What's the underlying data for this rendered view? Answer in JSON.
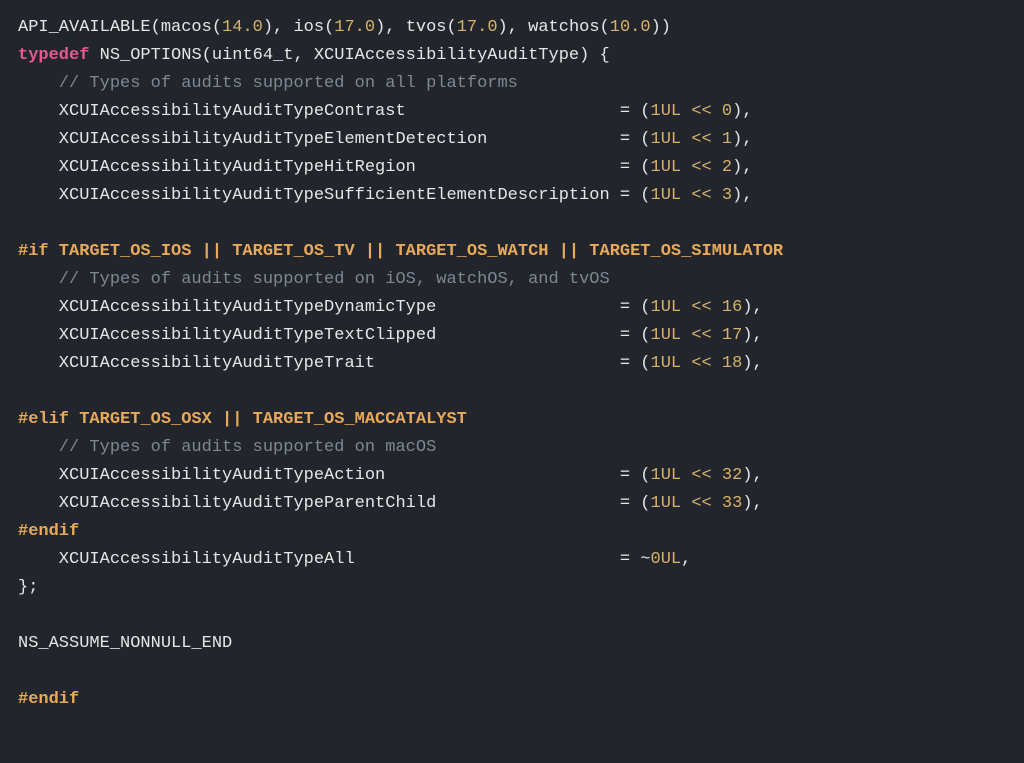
{
  "code": {
    "line1_api": "API_AVAILABLE(macos(",
    "line1_v1": "14.0",
    "line1_b": "), ios(",
    "line1_v2": "17.0",
    "line1_c": "), tvos(",
    "line1_v3": "17.0",
    "line1_d": "), watchos(",
    "line1_v4": "10.0",
    "line1_e": "))",
    "typedef": "typedef",
    "ns_opts": " NS_OPTIONS(uint64_t, XCUIAccessibilityAuditType) {",
    "cmt_all": "    // Types of audits supported on all platforms",
    "enum1_name": "    XCUIAccessibilityAuditTypeContrast                     = (",
    "enum1_val": "1UL << 0",
    "enum1_tail": "),",
    "enum2_name": "    XCUIAccessibilityAuditTypeElementDetection             = (",
    "enum2_val": "1UL << 1",
    "enum2_tail": "),",
    "enum3_name": "    XCUIAccessibilityAuditTypeHitRegion                    = (",
    "enum3_val": "1UL << 2",
    "enum3_tail": "),",
    "enum4_name": "    XCUIAccessibilityAuditTypeSufficientElementDescription = (",
    "enum4_val": "1UL << 3",
    "enum4_tail": "),",
    "blank": "    ",
    "pp_if": "#if TARGET_OS_IOS || TARGET_OS_TV || TARGET_OS_WATCH || TARGET_OS_SIMULATOR",
    "cmt_ios": "    // Types of audits supported on iOS, watchOS, and tvOS",
    "enum5_name": "    XCUIAccessibilityAuditTypeDynamicType                  = (",
    "enum5_val": "1UL << 16",
    "enum5_tail": "),",
    "enum6_name": "    XCUIAccessibilityAuditTypeTextClipped                  = (",
    "enum6_val": "1UL << 17",
    "enum6_tail": "),",
    "enum7_name": "    XCUIAccessibilityAuditTypeTrait                        = (",
    "enum7_val": "1UL << 18",
    "enum7_tail": "),",
    "pp_elif": "#elif TARGET_OS_OSX || TARGET_OS_MACCATALYST",
    "cmt_mac": "    // Types of audits supported on macOS",
    "enum8_name": "    XCUIAccessibilityAuditTypeAction                       = (",
    "enum8_val": "1UL << 32",
    "enum8_tail": "),",
    "enum9_name": "    XCUIAccessibilityAuditTypeParentChild                  = (",
    "enum9_val": "1UL << 33",
    "enum9_tail": "),",
    "pp_endif": "#endif",
    "enum10_name": "    XCUIAccessibilityAuditTypeAll                          = ~",
    "enum10_val": "0UL",
    "enum10_tail": ",",
    "close": "};",
    "nonnull": "NS_ASSUME_NONNULL_END",
    "pp_endif2": "#endif"
  }
}
